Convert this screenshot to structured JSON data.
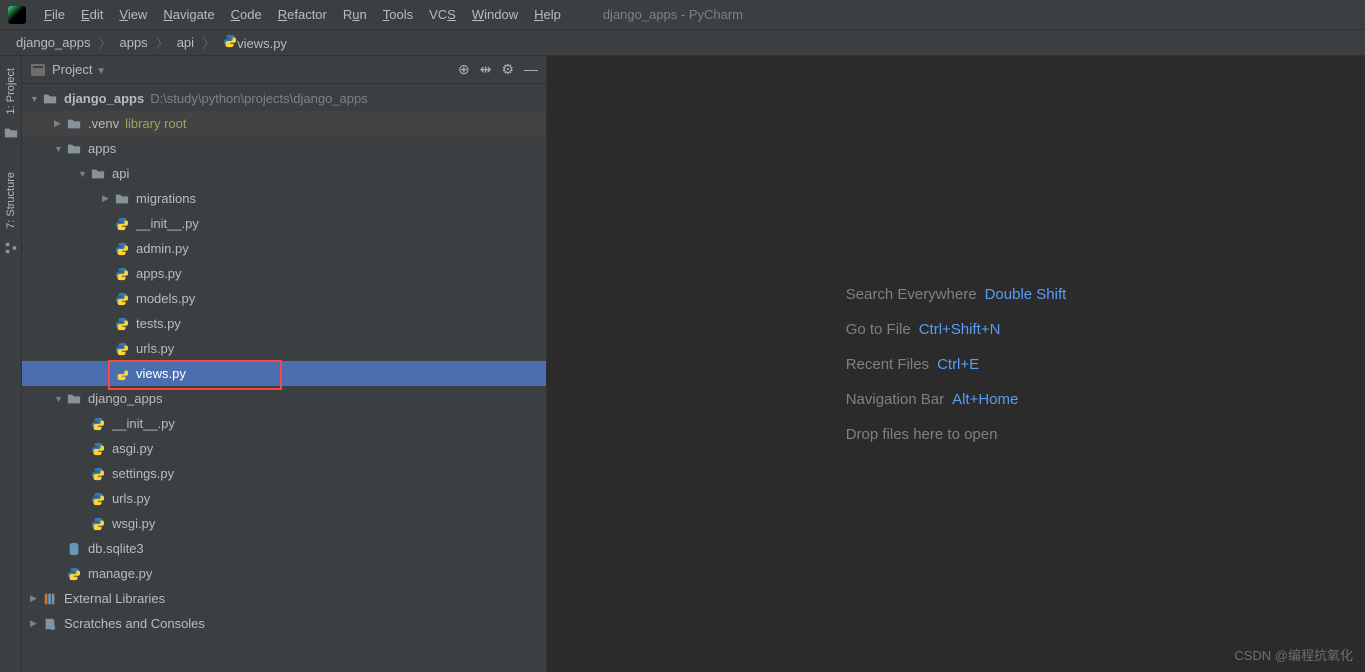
{
  "window_title": "django_apps - PyCharm",
  "menu": [
    {
      "label": "File",
      "mn": "F"
    },
    {
      "label": "Edit",
      "mn": "E"
    },
    {
      "label": "View",
      "mn": "V"
    },
    {
      "label": "Navigate",
      "mn": "N"
    },
    {
      "label": "Code",
      "mn": "C"
    },
    {
      "label": "Refactor",
      "mn": "R"
    },
    {
      "label": "Run",
      "mn": "u"
    },
    {
      "label": "Tools",
      "mn": "T"
    },
    {
      "label": "VCS",
      "mn": "S"
    },
    {
      "label": "Window",
      "mn": "W"
    },
    {
      "label": "Help",
      "mn": "H"
    }
  ],
  "breadcrumbs": [
    "django_apps",
    "apps",
    "api",
    "views.py"
  ],
  "panel": {
    "title": "Project"
  },
  "gutter": {
    "project": "1: Project",
    "structure": "7: Structure"
  },
  "tree": [
    {
      "depth": 0,
      "arrow": "down",
      "icon": "folder",
      "label": "django_apps",
      "bold": true,
      "hint": "D:\\study\\python\\projects\\django_apps",
      "hintClass": ""
    },
    {
      "depth": 1,
      "arrow": "right",
      "icon": "folder",
      "label": ".venv",
      "hint": "library root",
      "hintClass": "khaki",
      "rowClass": "venv"
    },
    {
      "depth": 1,
      "arrow": "down",
      "icon": "folder",
      "label": "apps"
    },
    {
      "depth": 2,
      "arrow": "down",
      "icon": "folder",
      "label": "api"
    },
    {
      "depth": 3,
      "arrow": "right",
      "icon": "folder",
      "label": "migrations"
    },
    {
      "depth": 3,
      "arrow": "",
      "icon": "py",
      "label": "__init__.py"
    },
    {
      "depth": 3,
      "arrow": "",
      "icon": "py",
      "label": "admin.py"
    },
    {
      "depth": 3,
      "arrow": "",
      "icon": "py",
      "label": "apps.py"
    },
    {
      "depth": 3,
      "arrow": "",
      "icon": "py",
      "label": "models.py"
    },
    {
      "depth": 3,
      "arrow": "",
      "icon": "py",
      "label": "tests.py"
    },
    {
      "depth": 3,
      "arrow": "",
      "icon": "py",
      "label": "urls.py"
    },
    {
      "depth": 3,
      "arrow": "",
      "icon": "py",
      "label": "views.py",
      "selected": true,
      "highlight": true
    },
    {
      "depth": 1,
      "arrow": "down",
      "icon": "folder",
      "label": "django_apps"
    },
    {
      "depth": 2,
      "arrow": "",
      "icon": "py",
      "label": "__init__.py"
    },
    {
      "depth": 2,
      "arrow": "",
      "icon": "py",
      "label": "asgi.py"
    },
    {
      "depth": 2,
      "arrow": "",
      "icon": "py",
      "label": "settings.py"
    },
    {
      "depth": 2,
      "arrow": "",
      "icon": "py",
      "label": "urls.py"
    },
    {
      "depth": 2,
      "arrow": "",
      "icon": "py",
      "label": "wsgi.py"
    },
    {
      "depth": 1,
      "arrow": "",
      "icon": "db",
      "label": "db.sqlite3"
    },
    {
      "depth": 1,
      "arrow": "",
      "icon": "py",
      "label": "manage.py"
    },
    {
      "depth": 0,
      "arrow": "right",
      "icon": "lib",
      "label": "External Libraries"
    },
    {
      "depth": 0,
      "arrow": "right",
      "icon": "scratch",
      "label": "Scratches and Consoles"
    }
  ],
  "hints": [
    {
      "label": "Search Everywhere",
      "key": "Double Shift"
    },
    {
      "label": "Go to File",
      "key": "Ctrl+Shift+N"
    },
    {
      "label": "Recent Files",
      "key": "Ctrl+E"
    },
    {
      "label": "Navigation Bar",
      "key": "Alt+Home"
    },
    {
      "label": "Drop files here to open",
      "key": ""
    }
  ],
  "watermark": "CSDN @编程抗氧化"
}
